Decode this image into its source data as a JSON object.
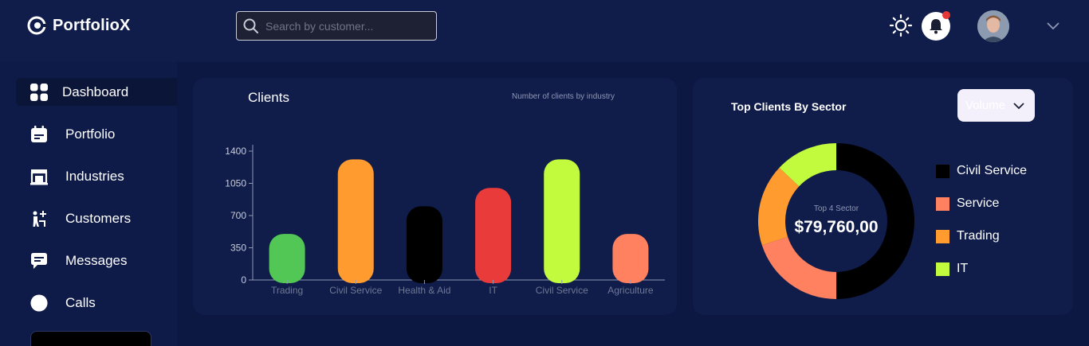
{
  "app": {
    "name": "PortfolioX",
    "search_placeholder": "Search by customer..."
  },
  "header": {
    "icons": [
      "sun-icon",
      "bell-icon",
      "avatar",
      "chevron-down-icon"
    ],
    "notification_dot_color": "#e53935"
  },
  "sidebar": {
    "items": [
      {
        "label": "Dashboard",
        "icon": "grid-icon",
        "active": true
      },
      {
        "label": "Portfolio",
        "icon": "calendar-icon",
        "active": false
      },
      {
        "label": "Industries",
        "icon": "building-icon",
        "active": false
      },
      {
        "label": "Customers",
        "icon": "person-add-icon",
        "active": false
      },
      {
        "label": "Messages",
        "icon": "chat-icon",
        "active": false
      },
      {
        "label": "Calls",
        "icon": "circle-icon",
        "active": false
      }
    ]
  },
  "clients_card": {
    "title": "Clients",
    "subtitle": "Number of clients by industry"
  },
  "sector_card": {
    "title": "Top Clients By Sector",
    "dropdown_value": "Volume",
    "donut_caption": "Top 4 Sector",
    "donut_total": "$79,760,00",
    "legend": [
      {
        "label": "Civil Service",
        "color": "#000000"
      },
      {
        "label": "Service",
        "color": "#ff8160"
      },
      {
        "label": "Trading",
        "color": "#ff9b2f"
      },
      {
        "label": "IT",
        "color": "#c2fb3e"
      }
    ]
  },
  "chart_data": [
    {
      "type": "bar",
      "title": "Clients",
      "subtitle": "Number of clients by industry",
      "categories": [
        "Trading",
        "Civil Service",
        "Health & Aid",
        "IT",
        "Civil Service",
        "Agriculture"
      ],
      "values": [
        500,
        1310,
        800,
        1000,
        1310,
        500
      ],
      "colors": [
        "#52c755",
        "#ff9b2f",
        "#000000",
        "#ea3b3b",
        "#c2fb3e",
        "#ff8160"
      ],
      "yticks": [
        0,
        350,
        700,
        1050,
        1400
      ],
      "ylim": [
        0,
        1400
      ],
      "grid": false
    },
    {
      "type": "pie",
      "labels": [
        "Civil Service",
        "Service",
        "Trading",
        "IT"
      ],
      "values": [
        50,
        20,
        17,
        13
      ],
      "colors": [
        "#000000",
        "#ff8160",
        "#ff9b2f",
        "#c2fb3e"
      ],
      "center_caption": "Top 4 Sector",
      "center_value": "$79,760,00"
    }
  ]
}
